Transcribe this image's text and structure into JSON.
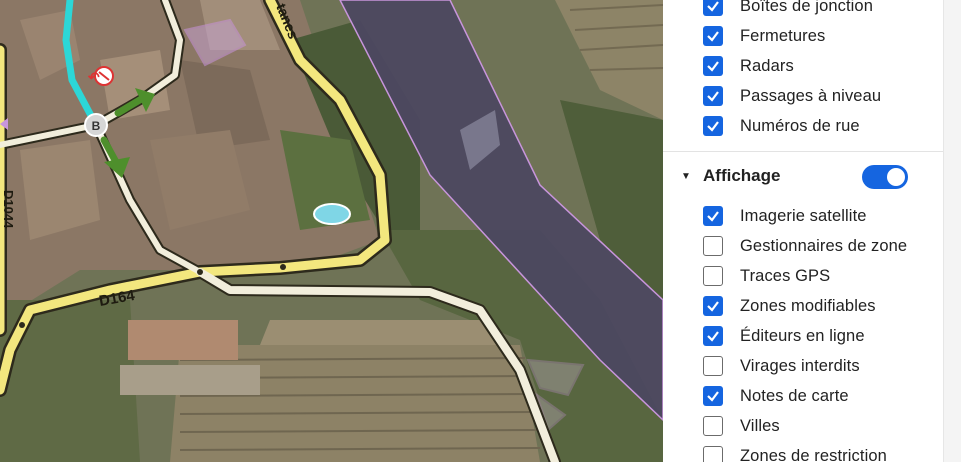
{
  "map": {
    "road_labels": {
      "d164": "D164",
      "d1044": "D1044",
      "tanes": "tanes"
    },
    "waypoint_label": "B",
    "colors": {
      "road_fill": "#f3e77e",
      "road_casing": "#3a3520",
      "route": "#2cd7d7",
      "arrow": "#4e8f2c",
      "area_outline": "#c895dc"
    }
  },
  "panel": {
    "top_items": [
      {
        "label": "Boîtes de jonction",
        "checked": true
      },
      {
        "label": "Fermetures",
        "checked": true
      },
      {
        "label": "Radars",
        "checked": true
      },
      {
        "label": "Passages à niveau",
        "checked": true
      },
      {
        "label": "Numéros de rue",
        "checked": true
      }
    ],
    "section": {
      "title": "Affichage",
      "toggle_on": true
    },
    "display_items": [
      {
        "label": "Imagerie satellite",
        "checked": true
      },
      {
        "label": "Gestionnaires de zone",
        "checked": false
      },
      {
        "label": "Traces GPS",
        "checked": false
      },
      {
        "label": "Zones modifiables",
        "checked": true
      },
      {
        "label": "Éditeurs en ligne",
        "checked": true
      },
      {
        "label": "Virages interdits",
        "checked": false
      },
      {
        "label": "Notes de carte",
        "checked": true
      },
      {
        "label": "Villes",
        "checked": false
      },
      {
        "label": "Zones de restriction",
        "checked": false
      }
    ],
    "accent": "#1565e0"
  }
}
